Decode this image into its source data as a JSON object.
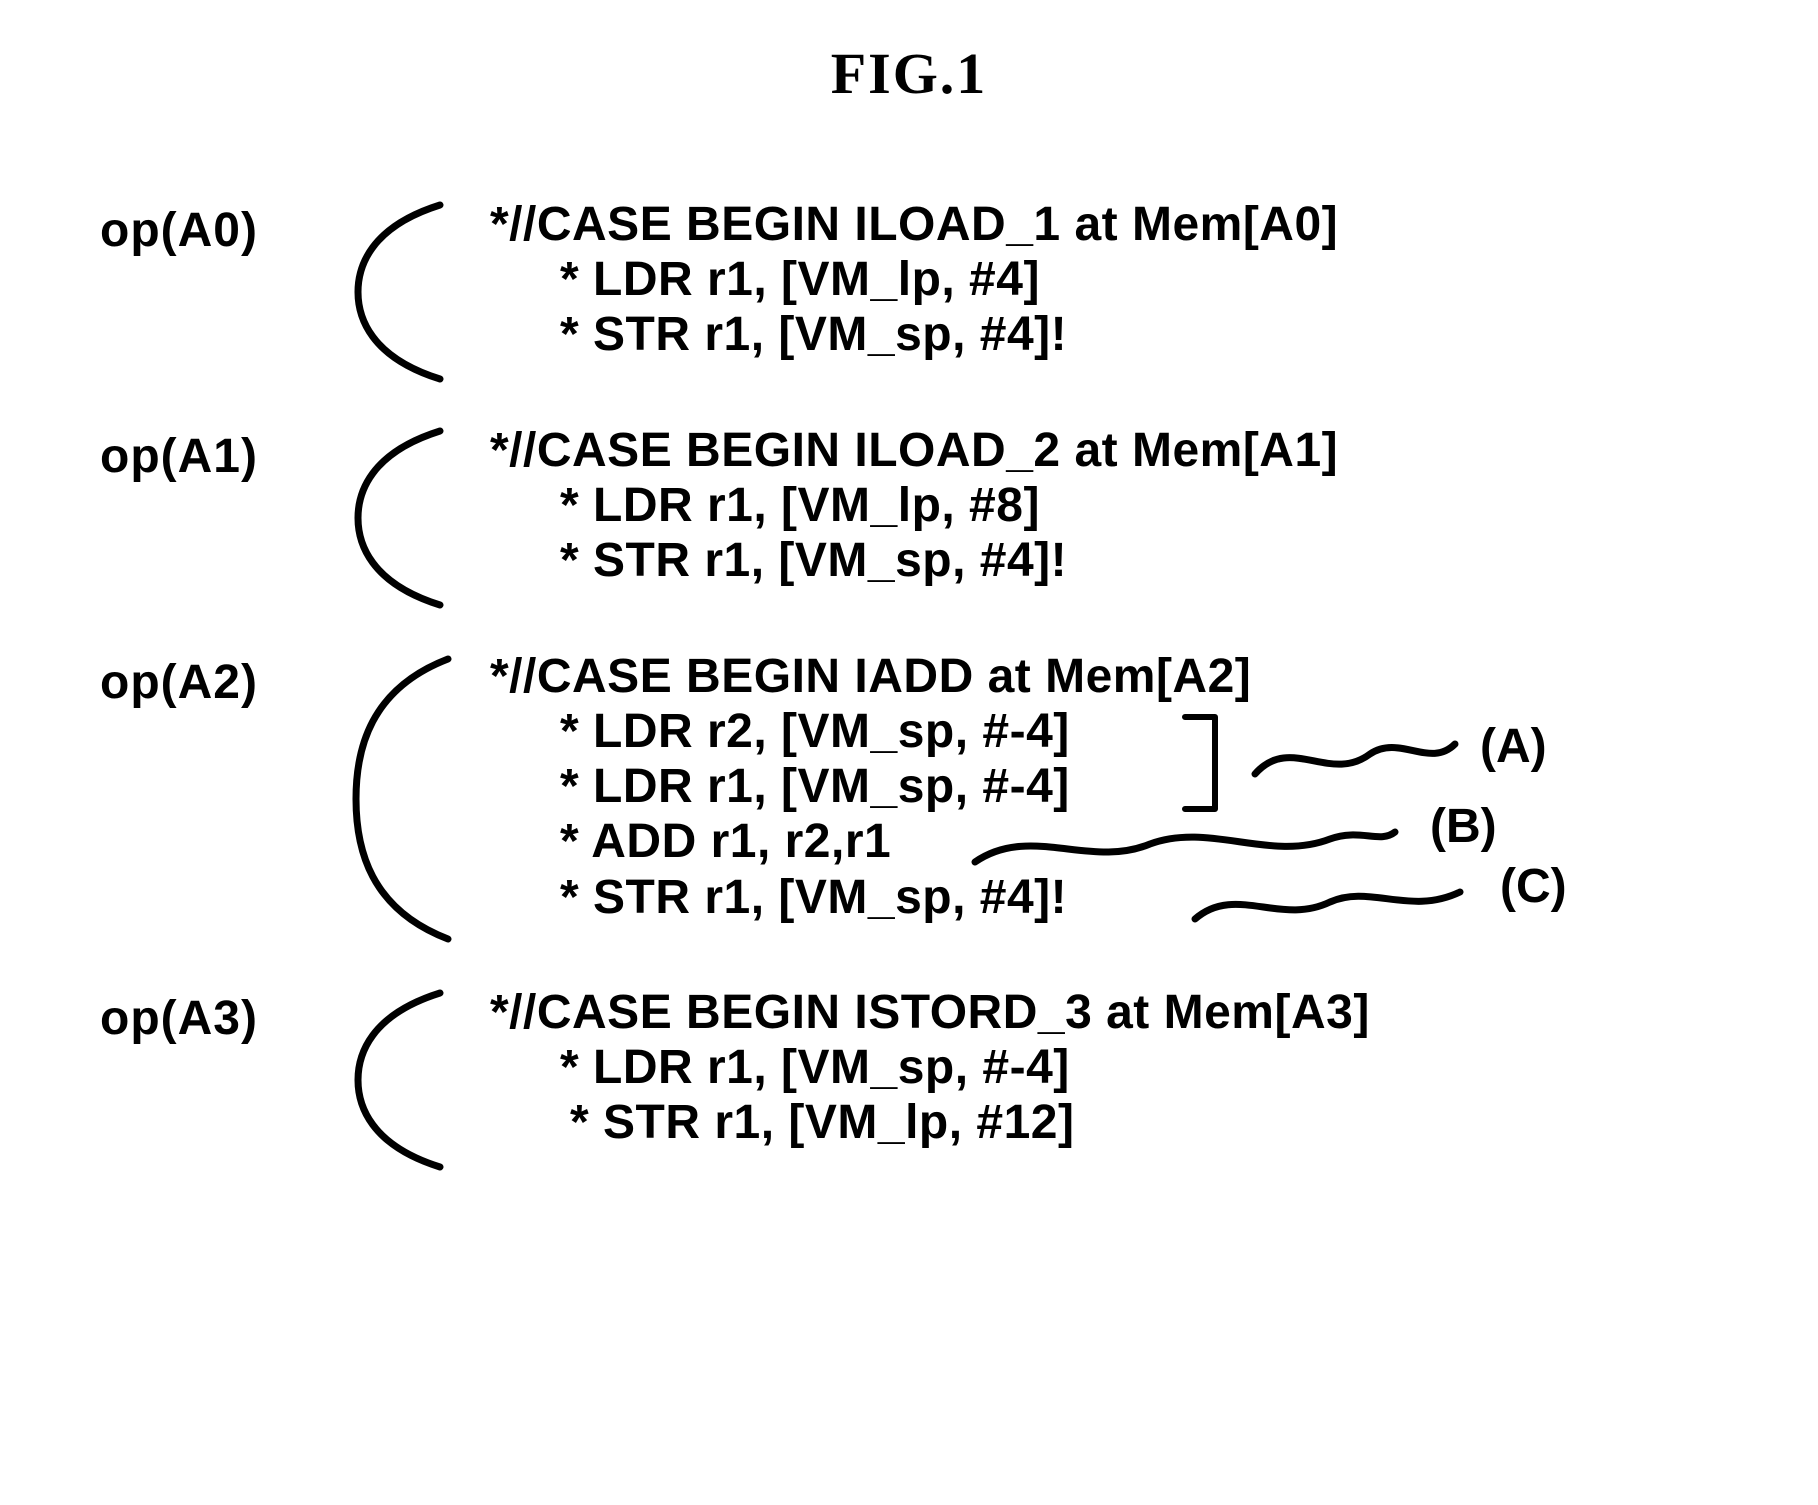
{
  "figure_title": "FIG.1",
  "blocks": [
    {
      "op": "op(A0)",
      "comment": "*//CASE BEGIN ILOAD_1 at Mem[A0]",
      "instrs": [
        "* LDR r1, [VM_lp, #4]",
        "* STR r1, [VM_sp, #4]!"
      ]
    },
    {
      "op": "op(A1)",
      "comment": "*//CASE BEGIN ILOAD_2 at Mem[A1]",
      "instrs": [
        "* LDR r1, [VM_lp, #8]",
        "* STR r1, [VM_sp, #4]!"
      ]
    },
    {
      "op": "op(A2)",
      "comment": "*//CASE BEGIN IADD at Mem[A2]",
      "instrs": [
        "* LDR  r2, [VM_sp, #-4]",
        "* LDR  r1, [VM_sp, #-4]",
        "* ADD r1, r2,r1",
        "* STR r1, [VM_sp, #4]!"
      ]
    },
    {
      "op": "op(A3)",
      "comment": "*//CASE BEGIN ISTORD_3 at Mem[A3]",
      "instrs": [
        "* LDR r1, [VM_sp, #-4]",
        "* STR r1, [VM_lp, #12]"
      ]
    }
  ],
  "annotations": {
    "A": "(A)",
    "B": "(B)",
    "C": "(C)"
  }
}
